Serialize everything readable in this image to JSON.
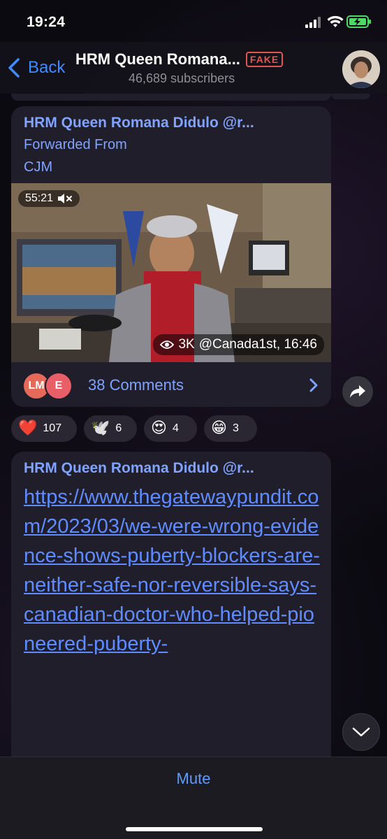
{
  "status_bar": {
    "time": "19:24"
  },
  "header": {
    "back_label": "Back",
    "title": "HRM Queen Romana...",
    "badge": "FAKE",
    "subtitle": "46,689 subscribers"
  },
  "messages": [
    {
      "sender": "HRM Queen Romana Didulo @r...",
      "forwarded_label": "Forwarded From",
      "forwarded_from": "CJM",
      "video": {
        "duration": "55:21",
        "views": "3K",
        "signature": "@Canada1st, 16:46"
      },
      "comment_avatars": [
        "LM",
        "E"
      ],
      "comments_label": "38 Comments",
      "reactions": [
        {
          "emoji": "❤️",
          "count": "107"
        },
        {
          "emoji": "🕊️",
          "count": "6"
        },
        {
          "emoji": "😍",
          "count": "4"
        },
        {
          "emoji": "😁",
          "count": "3"
        }
      ]
    },
    {
      "sender": "HRM Queen Romana Didulo @r...",
      "link": "https://www.thegatewaypundit.com/2023/03/we-were-wrong-evidence-shows-puberty-blockers-are-neither-safe-nor-reversible-says-canadian-doctor-who-helped-pioneered-puberty-"
    }
  ],
  "footer": {
    "mute_label": "Mute"
  },
  "colors": {
    "accent": "#3e8bff",
    "link": "#5e8cff",
    "name": "#7fa3ff",
    "fake": "#e0554d",
    "bubble": "#211e2b"
  }
}
